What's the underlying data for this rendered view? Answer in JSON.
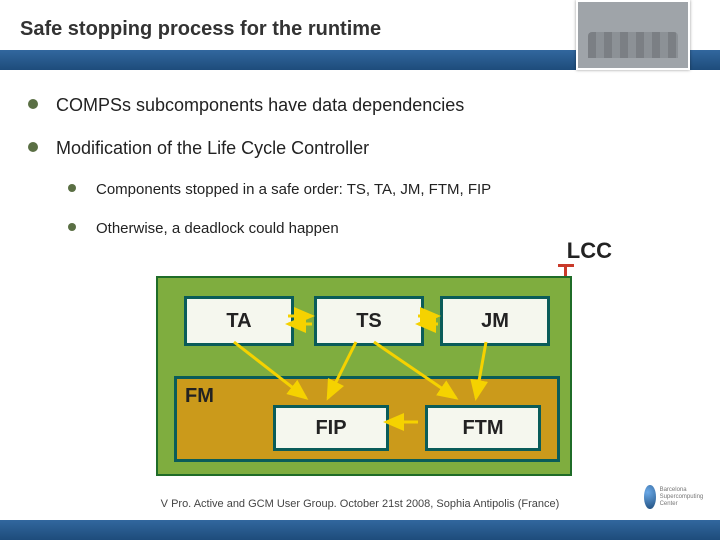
{
  "title": "Safe stopping process for the runtime",
  "bullets": {
    "a": "COMPSs subcomponents have data dependencies",
    "b": "Modification of the Life Cycle Controller",
    "c": "Components stopped in a safe order: TS, TA, JM, FTM, FIP",
    "d": "Otherwise, a deadlock could happen"
  },
  "lcc": "LCC",
  "diagram": {
    "ta": "TA",
    "ts": "TS",
    "jm": "JM",
    "fm": "FM",
    "fip": "FIP",
    "ftm": "FTM"
  },
  "footer": "V Pro. Active and GCM User Group. October 21st 2008, Sophia Antipolis (France)",
  "logo_text": "Barcelona\nSupercomputing\nCenter"
}
